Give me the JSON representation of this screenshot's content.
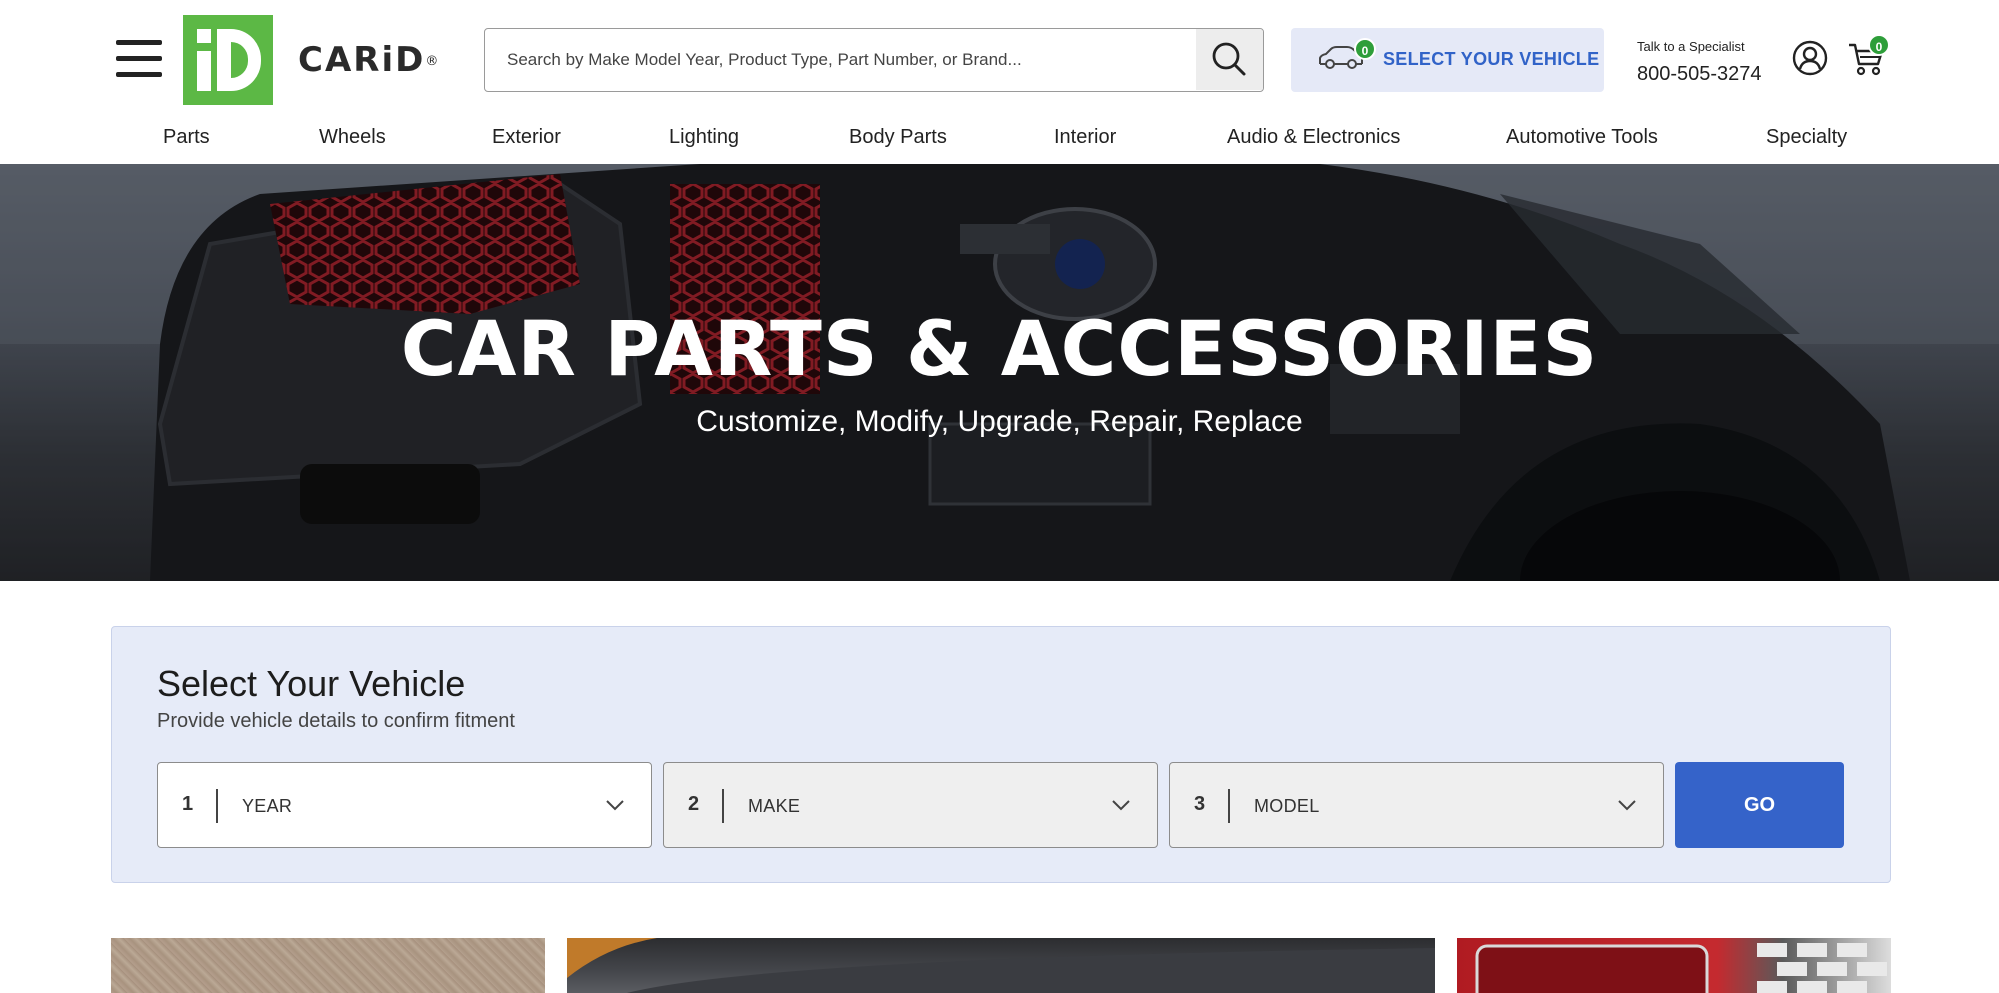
{
  "header": {
    "brand": "CARiD",
    "brand_mark": "®",
    "search": {
      "placeholder": "Search by Make Model Year, Product Type, Part Number, or Brand..."
    },
    "vehicle_button": {
      "label": "SELECT YOUR VEHICLE",
      "count": "0"
    },
    "specialist": {
      "label": "Talk to a Specialist",
      "phone": "800-505-3274"
    },
    "cart": {
      "count": "0"
    }
  },
  "nav": {
    "items": [
      {
        "label": "Parts"
      },
      {
        "label": "Wheels"
      },
      {
        "label": "Exterior"
      },
      {
        "label": "Lighting"
      },
      {
        "label": "Body Parts"
      },
      {
        "label": "Interior"
      },
      {
        "label": "Audio & Electronics"
      },
      {
        "label": "Automotive Tools"
      },
      {
        "label": "Specialty"
      }
    ]
  },
  "hero": {
    "title": "CAR PARTS & ACCESSORIES",
    "subtitle": "Customize, Modify, Upgrade, Repair, Replace"
  },
  "vehicle_selector": {
    "title": "Select Your Vehicle",
    "subtitle": "Provide vehicle details to confirm fitment",
    "fields": [
      {
        "step": "1",
        "label": "YEAR"
      },
      {
        "step": "2",
        "label": "MAKE"
      },
      {
        "step": "3",
        "label": "MODEL"
      }
    ],
    "go_label": "GO"
  },
  "colors": {
    "brand_green": "#5cb845",
    "accent_blue": "#3563c9",
    "badge_green": "#2e9e3a",
    "selector_bg": "#e6ebf8"
  }
}
